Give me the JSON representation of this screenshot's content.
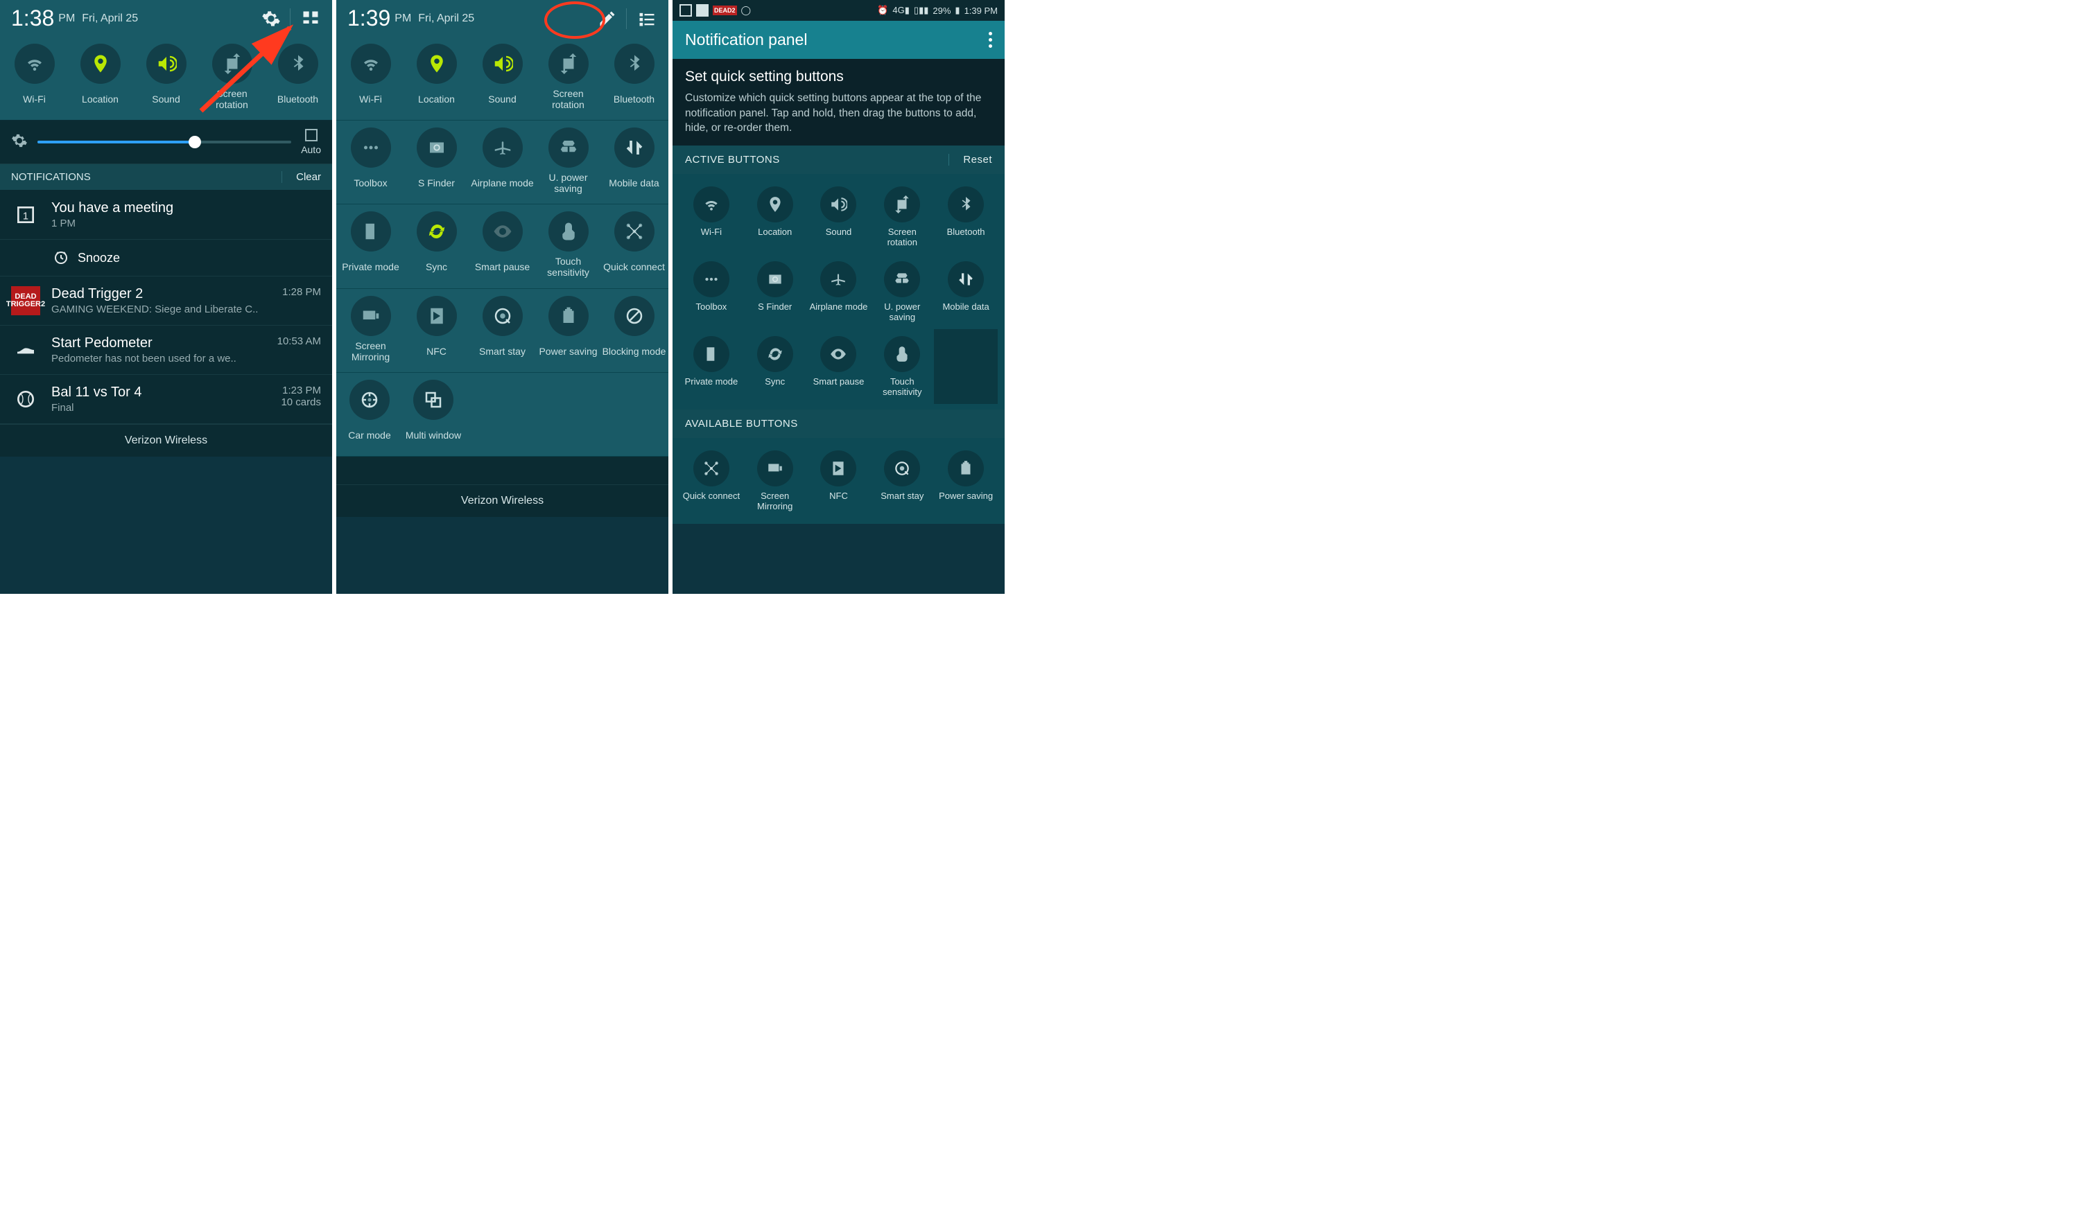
{
  "screen1": {
    "time": "1:38",
    "ampm": "PM",
    "date": "Fri, April 25",
    "toggles": [
      {
        "label": "Wi-Fi",
        "icon": "wifi",
        "active": false
      },
      {
        "label": "Location",
        "icon": "pin",
        "active": true
      },
      {
        "label": "Sound",
        "icon": "volume",
        "active": true
      },
      {
        "label": "Screen rotation",
        "icon": "rotate",
        "active": false
      },
      {
        "label": "Bluetooth",
        "icon": "bt",
        "active": false
      }
    ],
    "brightness": {
      "auto_label": "Auto",
      "slider_pct": 62
    },
    "notifications_header": "NOTIFICATIONS",
    "clear_label": "Clear",
    "notifications": [
      {
        "icon": "cal",
        "title": "You have a meeting",
        "sub": "1 PM",
        "time": ""
      },
      {
        "icon": "snooze",
        "title": "Snooze",
        "is_action": true
      },
      {
        "icon": "dead",
        "title": "Dead Trigger 2",
        "sub": "GAMING WEEKEND: Siege and Liberate C..",
        "time": "1:28 PM"
      },
      {
        "icon": "shoe",
        "title": "Start Pedometer",
        "sub": "Pedometer has not been used for a we..",
        "time": "10:53 AM"
      },
      {
        "icon": "ball",
        "title": "Bal 11 vs Tor 4",
        "sub": "Final",
        "time": "1:23 PM",
        "extra": "10 cards"
      }
    ],
    "footer": "Verizon Wireless"
  },
  "screen2": {
    "time": "1:39",
    "ampm": "PM",
    "date": "Fri, April 25",
    "toggles": [
      [
        {
          "label": "Wi-Fi",
          "icon": "wifi"
        },
        {
          "label": "Location",
          "icon": "pin",
          "active": true
        },
        {
          "label": "Sound",
          "icon": "volume",
          "active": true
        },
        {
          "label": "Screen rotation",
          "icon": "rotate"
        },
        {
          "label": "Bluetooth",
          "icon": "bt"
        }
      ],
      [
        {
          "label": "Toolbox",
          "icon": "dots"
        },
        {
          "label": "S Finder",
          "icon": "sfinder"
        },
        {
          "label": "Airplane mode",
          "icon": "plane"
        },
        {
          "label": "U. power saving",
          "icon": "recycle"
        },
        {
          "label": "Mobile data",
          "icon": "mdata",
          "active": true
        }
      ],
      [
        {
          "label": "Private mode",
          "icon": "private"
        },
        {
          "label": "Sync",
          "icon": "sync",
          "active": true
        },
        {
          "label": "Smart pause",
          "icon": "eye",
          "dim": true
        },
        {
          "label": "Touch sensitivity",
          "icon": "touch"
        },
        {
          "label": "Quick connect",
          "icon": "qconnect"
        }
      ],
      [
        {
          "label": "Screen Mirroring",
          "icon": "mirror"
        },
        {
          "label": "NFC",
          "icon": "nfc"
        },
        {
          "label": "Smart stay",
          "icon": "smartstay"
        },
        {
          "label": "Power saving",
          "icon": "battery"
        },
        {
          "label": "Blocking mode",
          "icon": "block"
        }
      ],
      [
        {
          "label": "Car mode",
          "icon": "car"
        },
        {
          "label": "Multi window",
          "icon": "multiwin",
          "active": true
        }
      ]
    ],
    "footer": "Verizon Wireless"
  },
  "screen3": {
    "statusbar": {
      "battery": "29%",
      "time": "1:39 PM"
    },
    "title": "Notification panel",
    "heading": "Set quick setting buttons",
    "body": "Customize which quick setting buttons appear at the top of the notification panel. Tap and hold, then drag the buttons to add, hide, or re-order them.",
    "active_hdr": "ACTIVE BUTTONS",
    "reset": "Reset",
    "active": [
      {
        "label": "Wi-Fi",
        "icon": "wifi"
      },
      {
        "label": "Location",
        "icon": "pin"
      },
      {
        "label": "Sound",
        "icon": "volume"
      },
      {
        "label": "Screen rotation",
        "icon": "rotate"
      },
      {
        "label": "Bluetooth",
        "icon": "bt"
      },
      {
        "label": "Toolbox",
        "icon": "dots"
      },
      {
        "label": "S Finder",
        "icon": "sfinder"
      },
      {
        "label": "Airplane mode",
        "icon": "plane"
      },
      {
        "label": "U. power saving",
        "icon": "recycle"
      },
      {
        "label": "Mobile data",
        "icon": "mdata"
      },
      {
        "label": "Private mode",
        "icon": "private"
      },
      {
        "label": "Sync",
        "icon": "sync"
      },
      {
        "label": "Smart pause",
        "icon": "eye"
      },
      {
        "label": "Touch sensitivity",
        "icon": "touch"
      },
      {
        "label": "",
        "icon": "",
        "empty": true
      }
    ],
    "avail_hdr": "AVAILABLE BUTTONS",
    "available": [
      {
        "label": "Quick connect",
        "icon": "qconnect"
      },
      {
        "label": "Screen Mirroring",
        "icon": "mirror"
      },
      {
        "label": "NFC",
        "icon": "nfc"
      },
      {
        "label": "Smart stay",
        "icon": "smartstay"
      },
      {
        "label": "Power saving",
        "icon": "battery"
      }
    ]
  },
  "icons": {
    "wifi": "<path d='M12 20c1 0 1.8-.8 1.8-1.8S13 16.4 12 16.4s-1.8.8-1.8 1.8S11 20 12 20zM4 10.6C6.2 8.5 9 7.4 12 7.4s5.8 1.1 8 3.2l-2 2c-1.6-1.5-3.7-2.4-6-2.4s-4.4.9-6 2.4zM7.2 13.8c1.3-1.2 3-2 4.8-2s3.5.8 4.8 2l-2 2c-.8-.7-1.8-1.2-2.8-1.2s-2 .5-2.8 1.2z'/>",
    "pin": "<path d='M12 2C8 2 5 5 5 9c0 5 7 13 7 13s7-8 7-13c0-4-3-7-7-7zm0 10a3 3 0 110-6 3 3 0 010 6z'/>",
    "volume": "<path d='M3 9v6h4l5 5V4L7 9zM16 7a5 5 0 010 10v-2a3 3 0 000-6zM16 3v2a7 7 0 010 14v2a9 9 0 000-18z'/>",
    "rotate": "<path d='M16 4h-3l4-4 4 4h-3v3h-2zM6 6h12v12H6zM8 20h3l-4 4-4-4h3v-3h2z'/>",
    "bt": "<path d='M12 2l6 5-4 4 4 4-6 5V13l-4 3-1-1 5-4-5-4 1-1 4 3z'/>",
    "dots": "<circle cx='6' cy='12' r='2'/><circle cx='12' cy='12' r='2'/><circle cx='18' cy='12' r='2'/>",
    "sfinder": "<path d='M4 6h16v12H4zM9 10h2v4H9zM13 10h2v4h-2z'/><circle cx='12' cy='12' r='3' fill='none' stroke='currentColor' stroke-width='1.5'/>",
    "plane": "<path d='M21 14l-8-2V6a1 1 0 00-2 0v6l-8 2v2l8-2v4l-2 1v1l3-.5 3 .5v-1l-2-1v-4l8 2z'/>",
    "recycle": "<path d='M7 4h10l2 3-2 3H7L5 7zM5 11l-2 3 2 3h6v-6zM13 11v6h6l2-3-2-3z'/>",
    "mdata": "<path d='M8 4v12l-4-4M16 20V8l4 4' stroke='currentColor' stroke-width='3' fill='none'/>",
    "private": "<path d='M6 3h10v18H6zM14 11a2 2 0 11-4 0 2 2 0 014 0z'/>",
    "sync": "<path d='M12 4a8 8 0 017 4l2-1-1 5-5-1 2-1a5 5 0 00-9 2H5a8 8 0 017-8zM12 20a8 8 0 01-7-4l-2 1 1-5 5 1-2 1a5 5 0 009-2h3a8 8 0 01-7 8z'/>",
    "eye": "<path d='M12 5C6 5 2 12 2 12s4 7 10 7 10-7 10-7-4-7-10-7zm0 11a4 4 0 110-8 4 4 0 010 8z'/>",
    "touch": "<path d='M12 2a4 4 0 014 4v4l3 3v5a4 4 0 01-4 4H9a4 4 0 01-4-4v-3l3-3V6a4 4 0 014-4z'/><circle cx='12' cy='6' r='1.5'/>",
    "qconnect": "<circle cx='12' cy='12' r='2'/><circle cx='5' cy='5' r='2'/><circle cx='19' cy='5' r='2'/><circle cx='5' cy='19' r='2'/><circle cx='19' cy='19' r='2'/><path d='M12 12L5 5M12 12l7-7M12 12l-7 7M12 12l7 7' stroke='currentColor'/>",
    "mirror": "<path d='M3 6h14v10H3zM18 9h3v6h-3z'/>",
    "nfc": "<path d='M5 3h14v18H5zM8 7v10l8-5z'/>",
    "smartstay": "<circle cx='12' cy='12' r='8' fill='none' stroke='currentColor' stroke-width='2'/><path d='M16 16l4 4' stroke='currentColor' stroke-width='2'/><circle cx='12' cy='12' r='3'/>",
    "battery": "<path d='M8 4h8v2h2v14H6V6h2zM10 2h4v2h-4z'/>",
    "block": "<circle cx='12' cy='12' r='8' fill='none' stroke='currentColor' stroke-width='2'/><path d='M6 18L18 6' stroke='currentColor' stroke-width='2'/>",
    "car": "<circle cx='12' cy='12' r='8' fill='none' stroke='currentColor' stroke-width='2'/><circle cx='12' cy='12' r='2'/><path d='M12 4v4M12 16v4M4 12h4M16 12h4' stroke='currentColor' stroke-width='2'/>",
    "multiwin": "<path d='M4 4h10v10H4zM10 10h10v10H10z' fill='none' stroke='currentColor' stroke-width='2'/>",
    "gear": "<path d='M12 8a4 4 0 100 8 4 4 0 000-8zm9 4a7 7 0 01-.1 1.2l2 1.6-2 3.4-2.4-.8a7 7 0 01-2 1.2l-.4 2.5h-4l-.4-2.5a7 7 0 01-2-1.2l-2.4.8-2-3.4 2-1.6A7 7 0 013 12a7 7 0 01.1-1.2l-2-1.6 2-3.4 2.4.8a7 7 0 012-1.2L8 2.9h4l.4 2.5a7 7 0 012 1.2l2.4-.8 2 3.4-2 1.6c0 .4.1.8.1 1.2z'/>",
    "grid": "<rect x='3' y='3' width='7' height='7'/><rect x='14' y='3' width='7' height='7'/><rect x='3' y='14' width='7' height='4'/><rect x='14' y='14' width='7' height='4'/>",
    "pencil": "<path d='M3 17l11-11 4 4L7 21H3zM15 5l2-2 4 4-2 2z'/>",
    "list": "<rect x='3' y='5' width='4' height='4'/><rect x='9' y='6' width='12' height='2'/><rect x='3' y='11' width='4' height='4'/><rect x='9' y='12' width='12' height='2'/><rect x='3' y='17' width='4' height='4'/><rect x='9' y='18' width='12' height='2'/>",
    "cal": "<rect x='4' y='4' width='16' height='16' fill='none' stroke='currentColor' stroke-width='2'/><text x='12' y='17' font-size='11' text-anchor='middle' fill='currentColor'>1</text>",
    "clock": "<circle cx='12' cy='12' r='8' fill='none' stroke='currentColor' stroke-width='2'/><path d='M8 4l-2 2M16 4l2 2M12 8v4l3 2' stroke='currentColor' stroke-width='2' fill='none'/>",
    "shoe": "<path d='M3 14c4 0 6-4 9-4 4 0 6 2 9 2v4H3z'/>",
    "ball": "<circle cx='12' cy='12' r='8' fill='none' stroke='currentColor' stroke-width='2'/><path d='M6 6c4 2 4 10 0 12M18 6c-4 2-4 10 0 12' stroke='currentColor' fill='none'/>"
  }
}
